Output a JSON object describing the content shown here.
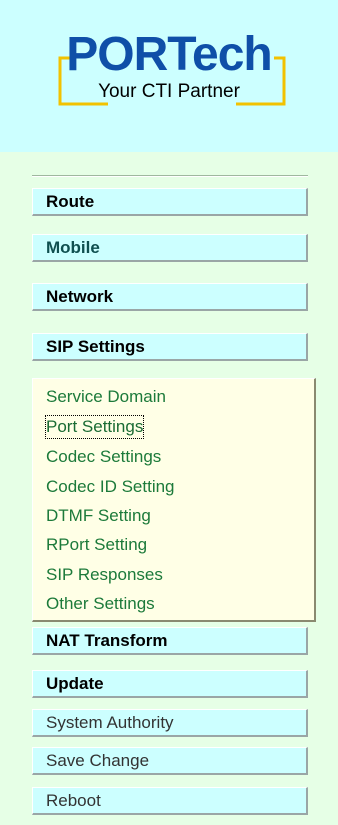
{
  "logo": {
    "main": "PORTech",
    "tagline": "Your CTI Partner"
  },
  "nav": {
    "route": "Route",
    "mobile": "Mobile",
    "network": "Network",
    "sip_settings": "SIP Settings",
    "nat_transform": "NAT Transform",
    "update": "Update",
    "system_authority": "System Authority",
    "save_change": "Save Change",
    "reboot": "Reboot"
  },
  "sip_submenu": [
    "Service Domain",
    "Port Settings",
    "Codec Settings",
    "Codec ID Setting",
    "DTMF Setting",
    "RPort Setting",
    "SIP Responses",
    "Other Settings"
  ],
  "colors": {
    "page_bg": "#e6ffe6",
    "logo_bg": "#ccffff",
    "button_bg": "#ccffff",
    "submenu_bg": "#ffffe6",
    "logo_text": "#0f4fa8",
    "bracket": "#f2c200",
    "submenu_text": "#1c7a3a"
  }
}
